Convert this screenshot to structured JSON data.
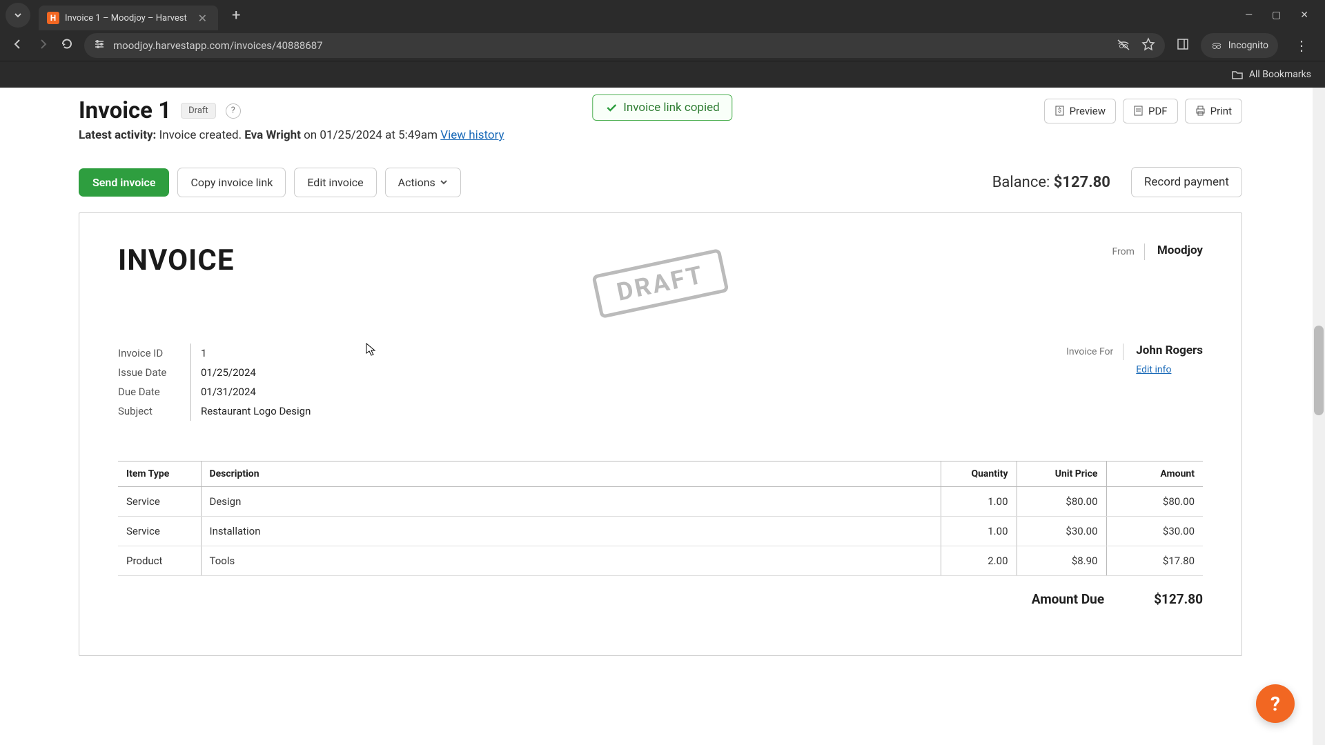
{
  "browser": {
    "tab_title": "Invoice 1 – Moodjoy – Harvest",
    "url": "moodjoy.harvestapp.com/invoices/40888687",
    "incognito_label": "Incognito",
    "bookmarks_label": "All Bookmarks"
  },
  "header": {
    "title": "Invoice 1",
    "status_badge": "Draft",
    "toast": "Invoice link copied",
    "preview": "Preview",
    "pdf": "PDF",
    "print": "Print"
  },
  "activity": {
    "prefix": "Latest activity:",
    "text": "Invoice created.",
    "actor": "Eva Wright",
    "on": "on 01/25/2024 at 5:49am",
    "history_link": "View history"
  },
  "actions": {
    "send": "Send invoice",
    "copy_link": "Copy invoice link",
    "edit": "Edit invoice",
    "actions": "Actions",
    "balance_label": "Balance: ",
    "balance_amount": "$127.80",
    "record_payment": "Record payment"
  },
  "invoice": {
    "word": "INVOICE",
    "stamp": "DRAFT",
    "from_label": "From",
    "from_name": "Moodjoy",
    "for_label": "Invoice For",
    "for_name": "John Rogers",
    "edit_info": "Edit info",
    "meta": {
      "invoice_id_label": "Invoice ID",
      "invoice_id": "1",
      "issue_date_label": "Issue Date",
      "issue_date": "01/25/2024",
      "due_date_label": "Due Date",
      "due_date": "01/31/2024",
      "subject_label": "Subject",
      "subject": "Restaurant Logo Design"
    },
    "columns": {
      "type": "Item Type",
      "desc": "Description",
      "qty": "Quantity",
      "unit": "Unit Price",
      "amt": "Amount"
    },
    "items": [
      {
        "type": "Service",
        "desc": "Design",
        "qty": "1.00",
        "unit": "$80.00",
        "amt": "$80.00"
      },
      {
        "type": "Service",
        "desc": "Installation",
        "qty": "1.00",
        "unit": "$30.00",
        "amt": "$30.00"
      },
      {
        "type": "Product",
        "desc": "Tools",
        "qty": "2.00",
        "unit": "$8.90",
        "amt": "$17.80"
      }
    ],
    "amount_due_label": "Amount Due",
    "amount_due": "$127.80"
  },
  "help_fab": "?"
}
